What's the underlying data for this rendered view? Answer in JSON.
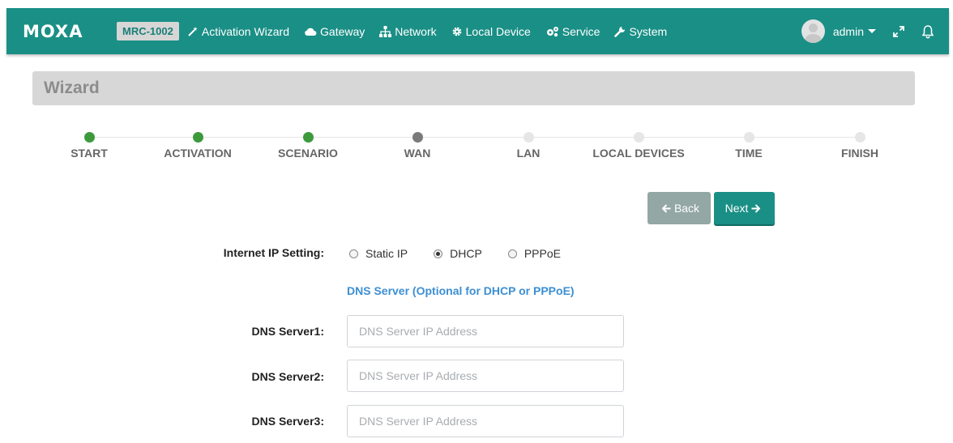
{
  "header": {
    "brand": "MOXA",
    "model": "MRC-1002",
    "nav": [
      {
        "label": "Activation Wizard",
        "icon": "magic-wand-icon"
      },
      {
        "label": "Gateway",
        "icon": "cloud-icon"
      },
      {
        "label": "Network",
        "icon": "sitemap-icon"
      },
      {
        "label": "Local Device",
        "icon": "gear-icon"
      },
      {
        "label": "Service",
        "icon": "gears-icon"
      },
      {
        "label": "System",
        "icon": "wrench-icon"
      }
    ],
    "user": "admin"
  },
  "wizard": {
    "title": "Wizard",
    "steps": [
      {
        "label": "START",
        "state": "done"
      },
      {
        "label": "ACTIVATION",
        "state": "done"
      },
      {
        "label": "SCENARIO",
        "state": "done"
      },
      {
        "label": "WAN",
        "state": "current"
      },
      {
        "label": "LAN",
        "state": "todo"
      },
      {
        "label": "LOCAL DEVICES",
        "state": "todo"
      },
      {
        "label": "TIME",
        "state": "todo"
      },
      {
        "label": "FINISH",
        "state": "todo"
      }
    ],
    "back_label": "Back",
    "next_label": "Next"
  },
  "form": {
    "ip_setting_label": "Internet IP Setting:",
    "ip_options": [
      {
        "label": "Static IP",
        "checked": false
      },
      {
        "label": "DHCP",
        "checked": true
      },
      {
        "label": "PPPoE",
        "checked": false
      }
    ],
    "dns_heading": "DNS Server (Optional for DHCP or PPPoE)",
    "dns_fields": [
      {
        "label": "DNS Server1:",
        "placeholder": "DNS Server IP Address",
        "value": ""
      },
      {
        "label": "DNS Server2:",
        "placeholder": "DNS Server IP Address",
        "value": ""
      },
      {
        "label": "DNS Server3:",
        "placeholder": "DNS Server IP Address",
        "value": ""
      }
    ]
  },
  "colors": {
    "primary": "#1a8f86",
    "step_done": "#3c9a3c",
    "step_current": "#7a7a7a",
    "step_todo": "#e6e6e6",
    "link_blue": "#3c8fd3"
  }
}
